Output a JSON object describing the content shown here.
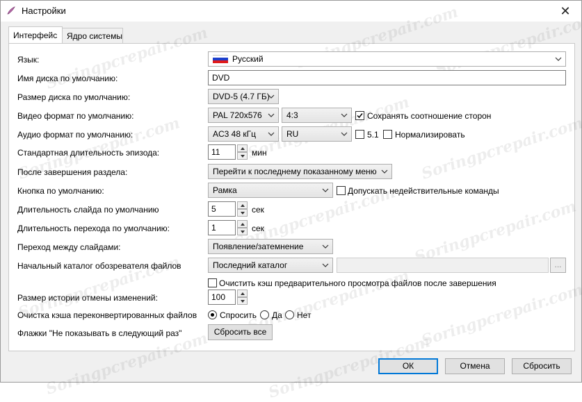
{
  "window": {
    "title": "Настройки",
    "close_icon": "close-icon",
    "app_icon": "quill-icon"
  },
  "tabs": [
    {
      "label": "Интерфейс",
      "active": true
    },
    {
      "label": "Ядро системы",
      "active": false
    }
  ],
  "fields": {
    "language": {
      "label": "Язык:",
      "value": "Русский",
      "flag_colors": [
        "#ffffff",
        "#1c3fcc",
        "#e01a1a"
      ]
    },
    "disk_name": {
      "label": "Имя диска по умолчанию:",
      "value": "DVD"
    },
    "disk_size": {
      "label": "Размер диска по умолчанию:",
      "value": "DVD-5 (4.7 ГБ)"
    },
    "video_format": {
      "label": "Видео формат по умолчанию:",
      "value": "PAL 720x576",
      "aspect": "4:3",
      "keep_aspect_label": "Сохранять соотношение сторон",
      "keep_aspect_checked": true
    },
    "audio_format": {
      "label": "Аудио формат по умолчанию:",
      "value": "AC3 48 кГц",
      "language": "RU",
      "surround_label": "5.1",
      "surround_checked": false,
      "normalize_label": "Нормализировать",
      "normalize_checked": false
    },
    "episode_length": {
      "label": "Стандартная длительность эпизода:",
      "value": "11",
      "unit": "мин"
    },
    "after_section": {
      "label": "После завершения раздела:",
      "value": "Перейти к последнему показанному меню"
    },
    "default_button": {
      "label": "Кнопка по умолчанию:",
      "value": "Рамка",
      "allow_invalid_label": "Допускать недействительные команды",
      "allow_invalid_checked": false
    },
    "slide_duration": {
      "label": "Длительность слайда по умолчанию",
      "value": "5",
      "unit": "сек"
    },
    "transition_duration": {
      "label": "Длительность перехода по умолчанию:",
      "value": "1",
      "unit": "сек"
    },
    "slide_transition": {
      "label": "Переход между слайдами:",
      "value": "Появление/затемнение"
    },
    "start_folder": {
      "label": "Начальный каталог обозревателя файлов",
      "value": "Последний каталог",
      "path": "",
      "browse_label": "..."
    },
    "clear_preview_cache": {
      "label": "Очистить кэш предварительного просмотра файлов после завершения",
      "checked": false
    },
    "undo_history": {
      "label": "Размер истории отмены изменений:",
      "value": "100"
    },
    "unconverted_cache": {
      "label": "Очистка кэша переконвертированных файлов",
      "options": [
        "Спросить",
        "Да",
        "Нет"
      ],
      "selected": "Спросить"
    },
    "dont_show_flags": {
      "label": "Флажки \"Не показывать в следующий раз\"",
      "button": "Сбросить все"
    }
  },
  "footer": {
    "ok": "ОК",
    "cancel": "Отмена",
    "reset": "Сбросить"
  },
  "watermark_text": "Soringpcrepair.com",
  "colors": {
    "default_button_border": "#0078d7",
    "panel_bg": "#ffffff",
    "window_bg": "#f0f0f0"
  }
}
